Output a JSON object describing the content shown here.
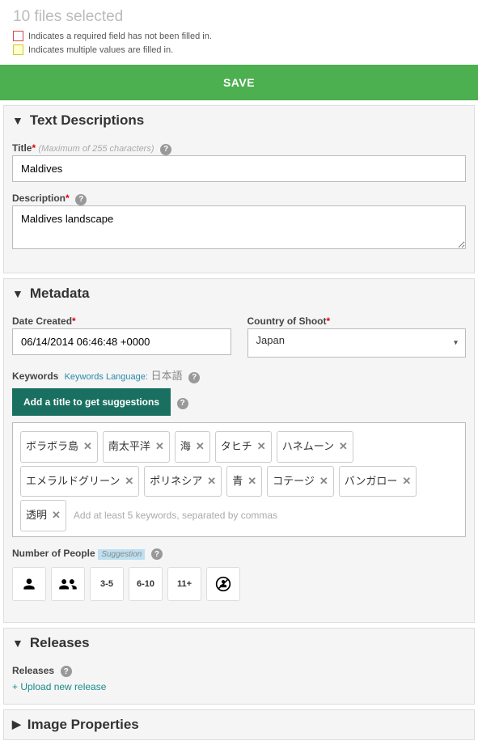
{
  "header": {
    "files_selected": "10 files selected",
    "legend_required": "Indicates a required field has not been filled in.",
    "legend_multi": "Indicates multiple values are filled in."
  },
  "save_label": "SAVE",
  "sections": {
    "text_desc": {
      "title": "Text Descriptions",
      "title_field": {
        "label": "Title",
        "hint": "(Maximum of 255 characters)",
        "value": "Maldives"
      },
      "desc_field": {
        "label": "Description",
        "value": "Maldives landscape"
      }
    },
    "metadata": {
      "title": "Metadata",
      "date_created": {
        "label": "Date Created",
        "value": "06/14/2014 06:46:48 +0000"
      },
      "country": {
        "label": "Country of Shoot",
        "value": "Japan"
      },
      "keywords": {
        "label": "Keywords",
        "lang_label": "Keywords Language:",
        "lang_value": "日本語",
        "suggest_btn": "Add a title to get suggestions",
        "tags": [
          "ボラボラ島",
          "南太平洋",
          "海",
          "タヒチ",
          "ハネムーン",
          "エメラルドグリーン",
          "ポリネシア",
          "青",
          "コテージ",
          "バンガロー",
          "透明"
        ],
        "placeholder": "Add at least 5 keywords, separated by commas"
      },
      "people": {
        "label": "Number of People",
        "suggestion_badge": "Suggestion",
        "opt_35": "3-5",
        "opt_610": "6-10",
        "opt_11": "11+"
      }
    },
    "releases": {
      "title": "Releases",
      "label": "Releases",
      "upload_link": "+ Upload new release"
    },
    "image_props": {
      "title": "Image Properties"
    }
  }
}
